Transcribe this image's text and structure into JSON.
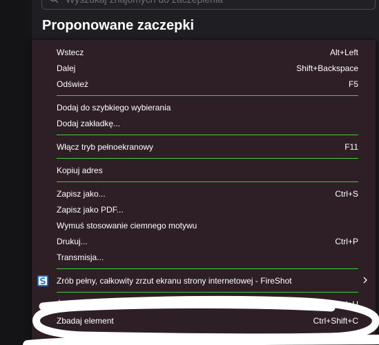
{
  "search": {
    "placeholder": "Wyszukaj znajomych do zaczepienia",
    "value": ""
  },
  "section": {
    "title": "Proponowane zaczepki"
  },
  "menu": {
    "items": [
      {
        "label": "Wstecz",
        "shortcut": "Alt+Left"
      },
      {
        "label": "Dalej",
        "shortcut": "Shift+Backspace"
      },
      {
        "label": "Odśwież",
        "shortcut": "F5"
      },
      {
        "label": "Dodaj do szybkiego wybierania",
        "shortcut": ""
      },
      {
        "label": "Dodaj zakładkę...",
        "shortcut": ""
      },
      {
        "label": "Włącz tryb pełnoekranowy",
        "shortcut": "F11"
      },
      {
        "label": "Kopiuj adres",
        "shortcut": ""
      },
      {
        "label": "Zapisz jako...",
        "shortcut": "Ctrl+S"
      },
      {
        "label": "Zapisz jako PDF...",
        "shortcut": ""
      },
      {
        "label": "Wymuś stosowanie ciemnego motywu",
        "shortcut": ""
      },
      {
        "label": "Drukuj...",
        "shortcut": "Ctrl+P"
      },
      {
        "label": "Transmisja...",
        "shortcut": ""
      },
      {
        "label": "Zrób pełny, całkowity zrzut ekranu strony internetowej - FireShot",
        "shortcut": "",
        "icon": "fireshot-icon",
        "submenu": true
      },
      {
        "label": "Źródło",
        "shortcut": "Ctrl+U"
      },
      {
        "label": "Zbadaj element",
        "shortcut": "Ctrl+Shift+C"
      }
    ]
  },
  "colors": {
    "background": "#1b1b1f",
    "menu_background": "#2e1e26",
    "separator": "#3fcf3a",
    "text": "#ffffff",
    "fireshot_brand": "#1f6fc5"
  }
}
